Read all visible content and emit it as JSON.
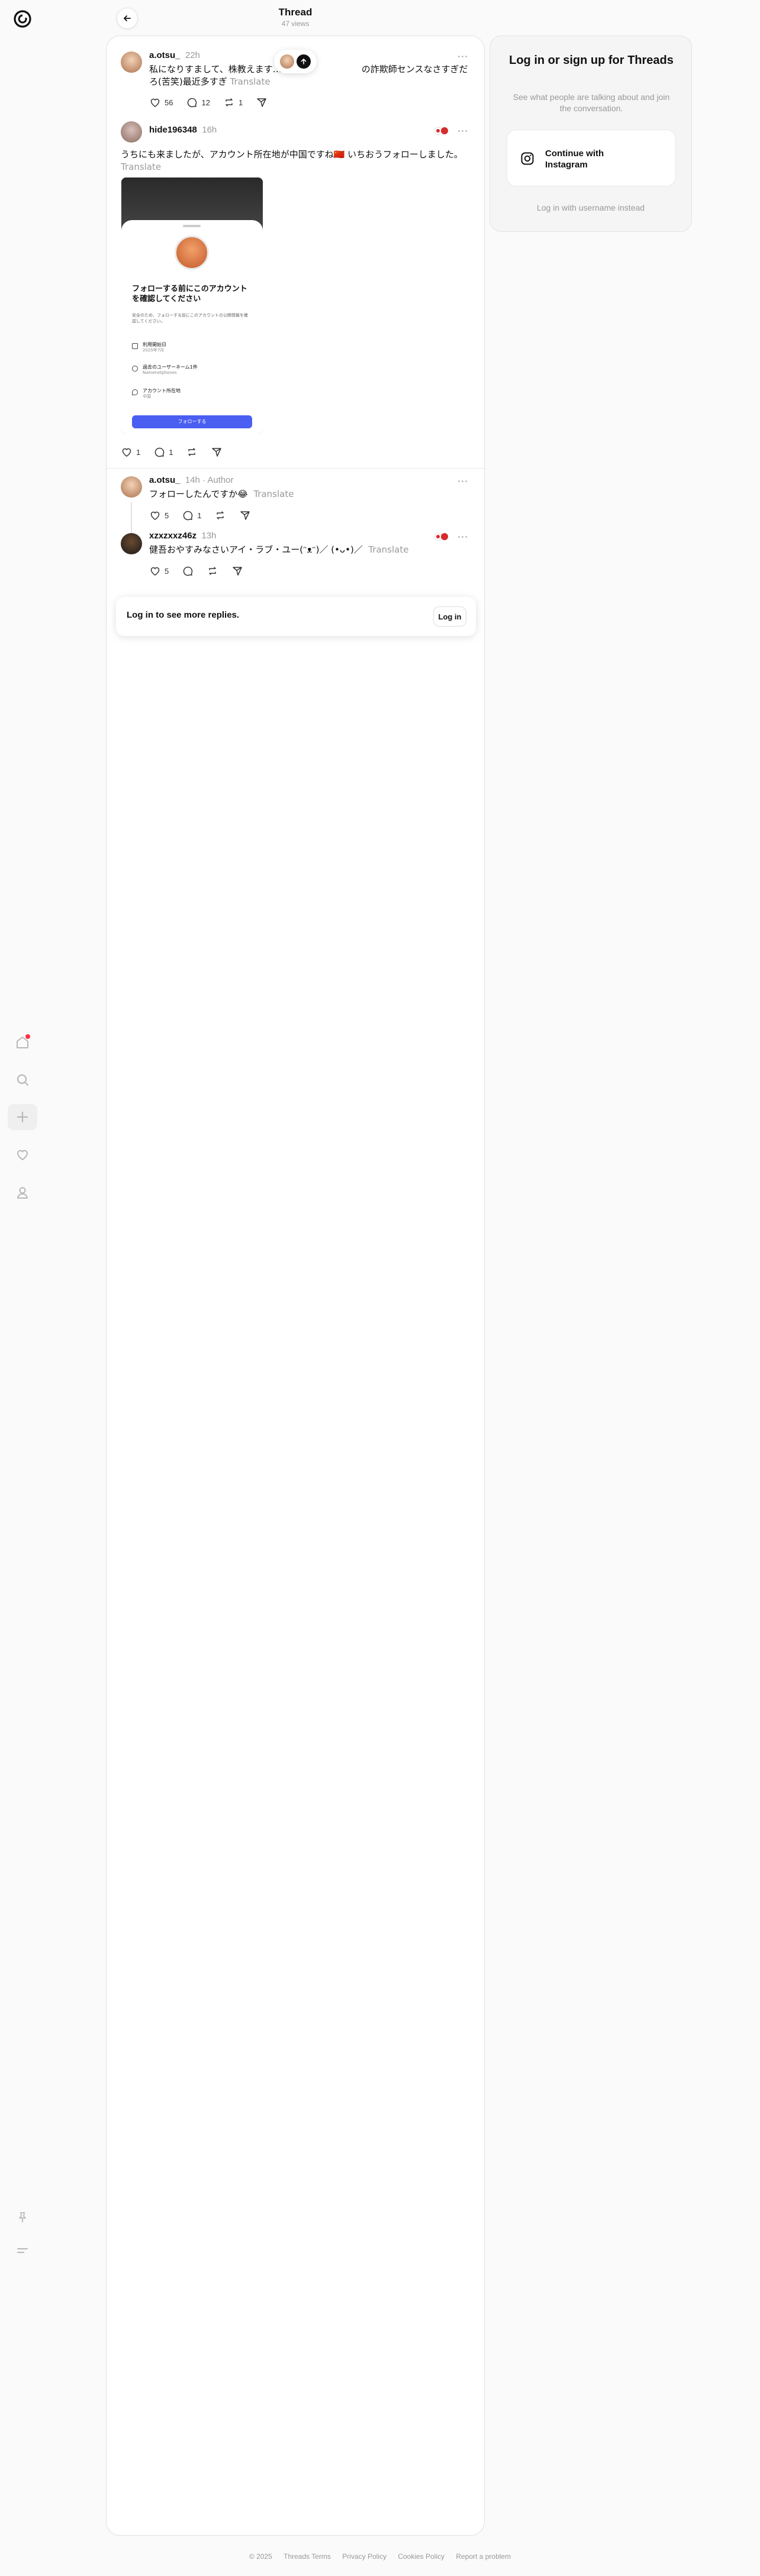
{
  "header": {
    "title": "Thread",
    "views": "47 views"
  },
  "nav": {
    "items": [
      "home-icon",
      "search-icon",
      "plus-icon",
      "heart-icon",
      "user-icon"
    ],
    "bottom": [
      "pin-icon",
      "menu-icon"
    ]
  },
  "posts": [
    {
      "username": "a.otsu_",
      "time": "22h",
      "text": "私になりすまして、株教えます…　　　　　　　　　の詐欺師センスなさすぎだろ(苦笑)最近多すぎ",
      "translate": "Translate",
      "likes": "56",
      "replies": "12",
      "reposts": "1"
    },
    {
      "username": "hide196348",
      "time": "16h",
      "text": "うちにも来ましたが、アカウント所在地が中国ですね🇨🇳 いちおうフォローしました。",
      "translate": "Translate",
      "likes": "1",
      "replies": "1",
      "image": {
        "title": "フォローする前にこのアカウントを確認してください",
        "subtitle": "安全のため、フォローする前にこのアカウントの公開情報を確認してください。",
        "rows": [
          {
            "label": "利用開始日",
            "value": "2025年7月"
          },
          {
            "label": "過去のユーザーネーム1件",
            "value": "Namenetphones"
          },
          {
            "label": "アカウント所在地",
            "value": "中国"
          }
        ],
        "button": "フォローする"
      }
    },
    {
      "username": "a.otsu_",
      "time": "14h",
      "author": "Author",
      "text": "フォローしたんですか😂",
      "translate": "Translate",
      "likes": "5",
      "replies": "1"
    },
    {
      "username": "xzxzxxz46z",
      "time": "13h",
      "text": "健吾おやすみなさいアイ・ラブ・ユー(ᵔᴥᵔ)／ (•ᴗ•)／",
      "translate": "Translate",
      "likes": "5"
    }
  ],
  "more_replies": {
    "text": "Log in to see more replies.",
    "button": "Log in"
  },
  "login_card": {
    "title": "Log in or sign up for Threads",
    "subtitle": "See what people are talking about and join the conversation.",
    "instagram_button": "Continue with Instagram",
    "alt_login": "Log in with username instead"
  },
  "footer": [
    "© 2025",
    "Threads Terms",
    "Privacy Policy",
    "Cookies Policy",
    "Report a problem"
  ],
  "colors": {
    "accent": "#4a5ef2",
    "notification": "#ff3040",
    "muted": "#999999"
  }
}
